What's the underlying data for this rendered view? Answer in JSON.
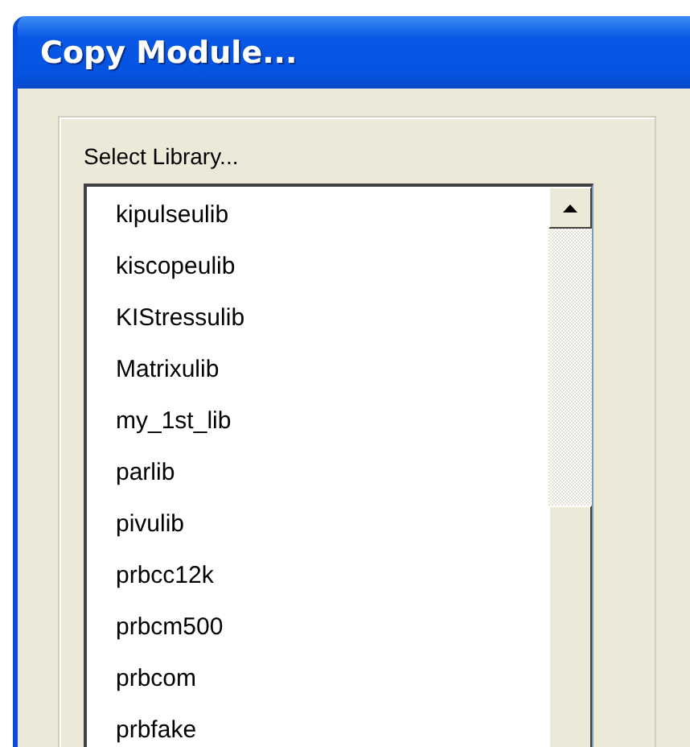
{
  "window": {
    "title": "Copy Module..."
  },
  "library_group": {
    "label": "Select Library...",
    "items": [
      {
        "label": "kipulseulib",
        "selected": false
      },
      {
        "label": "kiscopeulib",
        "selected": false
      },
      {
        "label": "KIStressulib",
        "selected": false
      },
      {
        "label": "Matrixulib",
        "selected": false
      },
      {
        "label": "my_1st_lib",
        "selected": false
      },
      {
        "label": "parlib",
        "selected": false
      },
      {
        "label": "pivulib",
        "selected": false
      },
      {
        "label": "prbcc12k",
        "selected": false
      },
      {
        "label": "prbcm500",
        "selected": false
      },
      {
        "label": "prbcom",
        "selected": false
      },
      {
        "label": "prbfake",
        "selected": false
      }
    ]
  }
}
